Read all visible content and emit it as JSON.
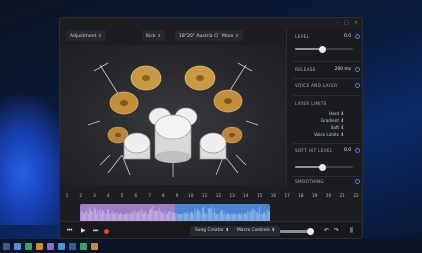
{
  "toolbar": {
    "adjustment": "Adjustment",
    "kick": "Kick",
    "kit": "18\"20\" Austria Classic",
    "more": "More"
  },
  "panel": {
    "level_label": "LEVEL",
    "level_value": "0.0",
    "level_fraction": 0.48,
    "release_label": "RELEASE",
    "release_value": "200 ms",
    "voice_layer_label": "VOICE AND LAYER",
    "layer_limits_label": "LAYER LIMITS",
    "layer_limits": [
      {
        "key": "Hard",
        "value": "4"
      },
      {
        "key": "Gradient",
        "value": "4"
      },
      {
        "key": "Soft",
        "value": "4"
      },
      {
        "key": "Voice Limits",
        "value": "4"
      }
    ],
    "soft_hit_label": "SOFT HIT LEVEL",
    "soft_hit_value": "0.0",
    "soft_hit_fraction": 0.48,
    "smoothing_label": "SMOOTHING"
  },
  "timeline": {
    "ticks": [
      "1",
      "2",
      "3",
      "4",
      "5",
      "6",
      "7",
      "8",
      "9",
      "10",
      "11",
      "12",
      "13",
      "14",
      "15",
      "16",
      "17",
      "18",
      "19",
      "20",
      "21",
      "22"
    ]
  },
  "transport": {
    "song_creator": "Song Creator",
    "macro_controls": "Macro Controls",
    "volume_fraction": 0.9
  },
  "colors": {
    "accent": "#3f7fe0",
    "clip_a": "#9d7fc9",
    "clip_b": "#4a86d4",
    "record": "#e0463c"
  }
}
